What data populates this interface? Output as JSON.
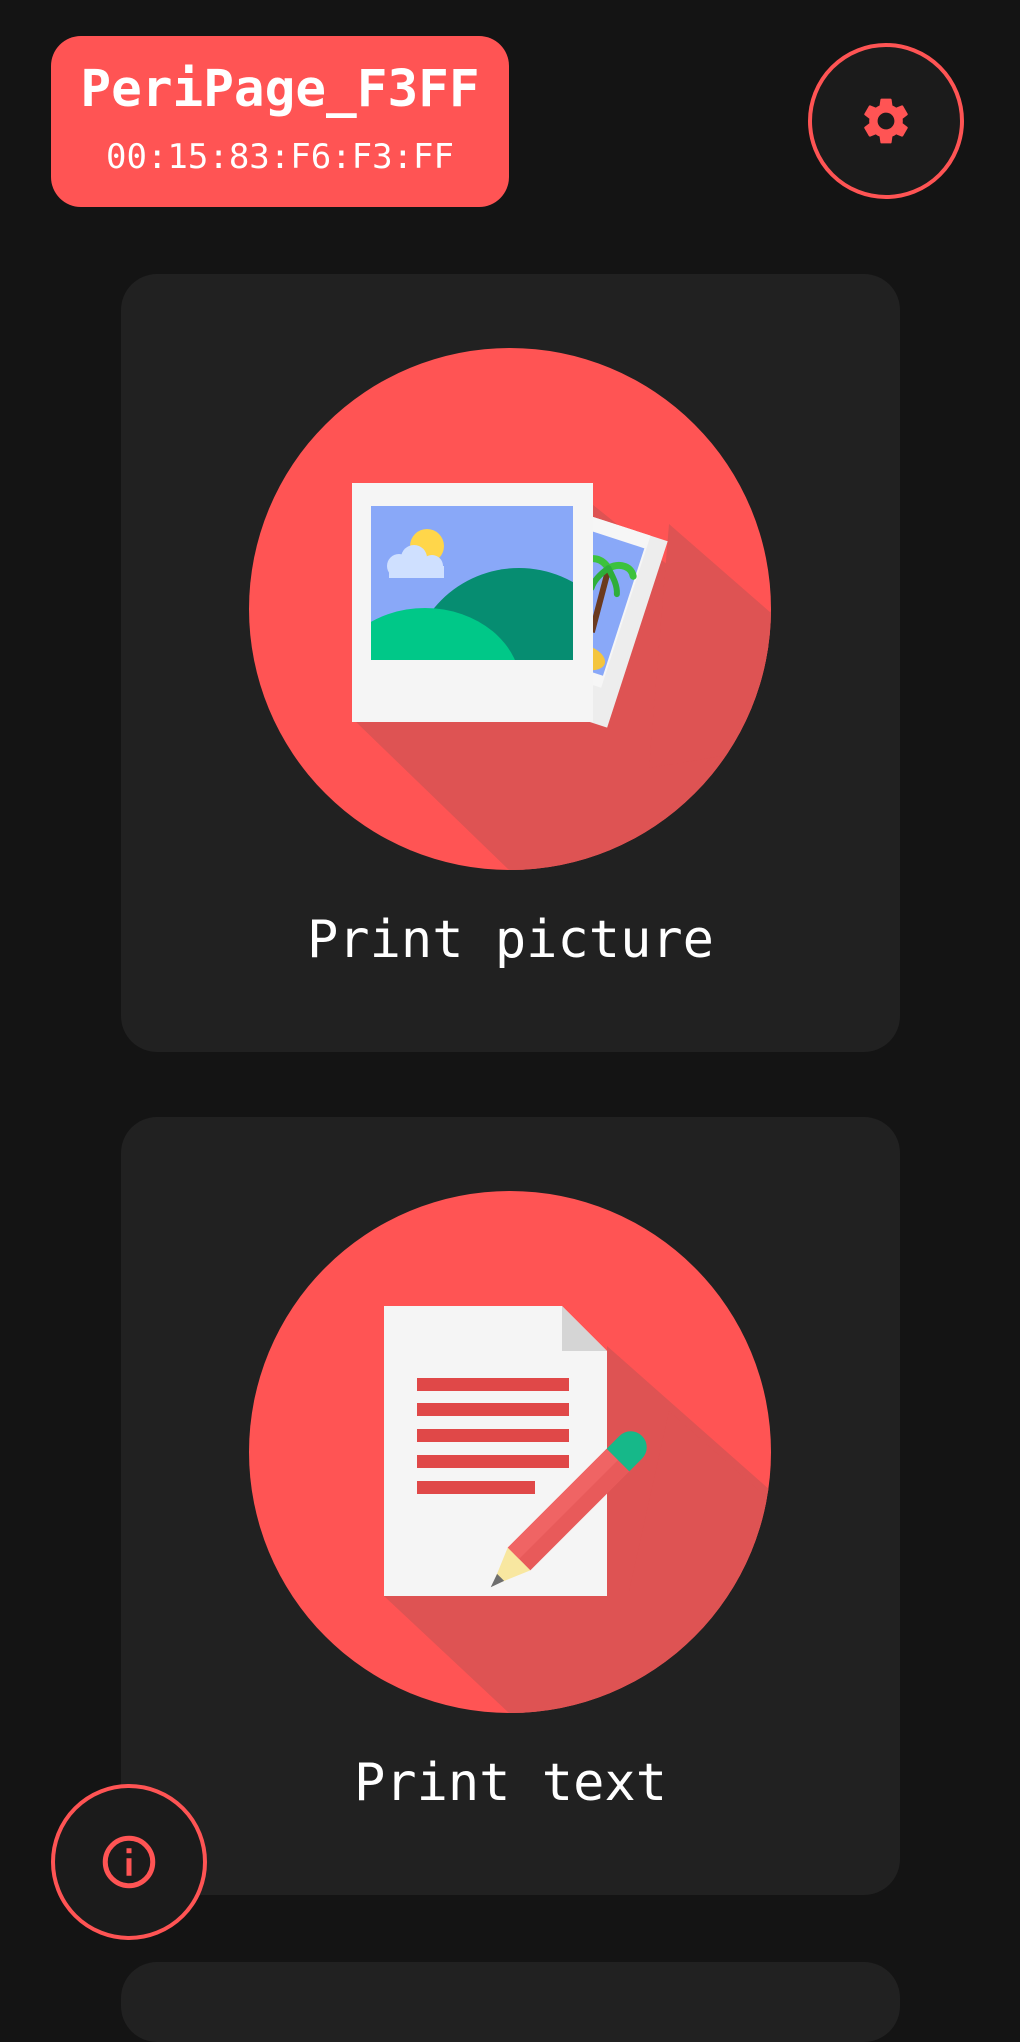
{
  "header": {
    "device_name": "PeriPage_F3FF",
    "device_mac": "00:15:83:F6:F3:FF",
    "settings_icon": "gear-icon"
  },
  "cards": {
    "picture": {
      "label": "Print picture",
      "icon": "pictures-icon"
    },
    "text": {
      "label": "Print text",
      "icon": "document-pencil-icon"
    }
  },
  "footer": {
    "info_icon": "info-icon"
  },
  "colors": {
    "accent": "#FF5454",
    "background": "#141414",
    "card": "#212121",
    "text": "#FFFFFF"
  }
}
